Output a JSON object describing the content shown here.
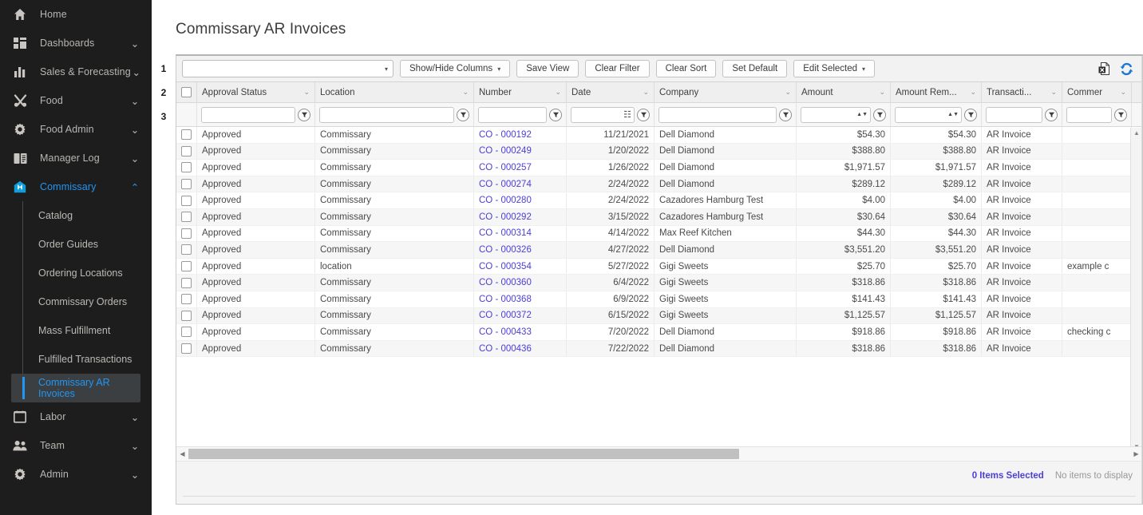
{
  "sidebar": {
    "items": [
      {
        "label": "Home",
        "icon": "home-icon",
        "expandable": false
      },
      {
        "label": "Dashboards",
        "icon": "dashboard-icon",
        "expandable": true,
        "chevron": "⌄"
      },
      {
        "label": "Sales & Forecasting",
        "icon": "bar-chart-icon",
        "expandable": true,
        "chevron": "⌄"
      },
      {
        "label": "Food",
        "icon": "utensils-icon",
        "expandable": true,
        "chevron": "⌄"
      },
      {
        "label": "Food Admin",
        "icon": "gear-icon",
        "expandable": true,
        "chevron": "⌄"
      },
      {
        "label": "Manager Log",
        "icon": "book-icon",
        "expandable": true,
        "chevron": "⌄"
      },
      {
        "label": "Commissary",
        "icon": "commissary-icon",
        "expandable": true,
        "chevron": "⌃",
        "active": true
      }
    ],
    "sub_items": [
      {
        "label": "Catalog"
      },
      {
        "label": "Order Guides"
      },
      {
        "label": "Ordering Locations"
      },
      {
        "label": "Commissary Orders"
      },
      {
        "label": "Mass Fulfillment"
      },
      {
        "label": "Fulfilled Transactions"
      },
      {
        "label": "Commissary AR Invoices",
        "current": true
      }
    ],
    "bottom_items": [
      {
        "label": "Labor",
        "icon": "calendar-icon",
        "chevron": "⌄"
      },
      {
        "label": "Team",
        "icon": "people-icon",
        "chevron": "⌄"
      },
      {
        "label": "Admin",
        "icon": "gear-icon",
        "chevron": "⌄"
      }
    ],
    "accent_color": "#2196f3"
  },
  "page": {
    "title": "Commissary AR Invoices",
    "markers": [
      "1",
      "2",
      "3"
    ]
  },
  "toolbar": {
    "view_select_value": "",
    "view_select_caret": "▾",
    "show_hide_columns": "Show/Hide Columns",
    "show_hide_caret": "▾",
    "save_view": "Save View",
    "clear_filter": "Clear Filter",
    "clear_sort": "Clear Sort",
    "set_default": "Set Default",
    "edit_selected": "Edit Selected",
    "edit_selected_caret": "▾",
    "export_icon": "export-excel-icon",
    "refresh_icon": "refresh-icon"
  },
  "grid": {
    "columns": [
      {
        "key": "check",
        "label": "",
        "width": 26,
        "type": "check",
        "filter": "none"
      },
      {
        "key": "status",
        "label": "Approval Status",
        "width": 148,
        "type": "text",
        "filter": "text"
      },
      {
        "key": "location",
        "label": "Location",
        "width": 199,
        "type": "text",
        "filter": "text"
      },
      {
        "key": "number",
        "label": "Number",
        "width": 116,
        "type": "link",
        "filter": "text"
      },
      {
        "key": "date",
        "label": "Date",
        "width": 110,
        "type": "num",
        "filter": "date"
      },
      {
        "key": "company",
        "label": "Company",
        "width": 178,
        "type": "text",
        "filter": "text"
      },
      {
        "key": "amount",
        "label": "Amount",
        "width": 118,
        "type": "num",
        "filter": "spin"
      },
      {
        "key": "remaining",
        "label": "Amount Rem...",
        "width": 114,
        "type": "num",
        "filter": "spin"
      },
      {
        "key": "trantype",
        "label": "Transacti...",
        "width": 101,
        "type": "text",
        "filter": "text"
      },
      {
        "key": "comment",
        "label": "Commer",
        "width": 87,
        "type": "text",
        "filter": "text"
      }
    ],
    "header_chevron": "⌄",
    "rows": [
      {
        "status": "Approved",
        "location": "Commissary",
        "number": "CO - 000192",
        "date": "11/21/2021",
        "company": "Dell Diamond",
        "amount": "$54.30",
        "remaining": "$54.30",
        "trantype": "AR Invoice",
        "comment": ""
      },
      {
        "status": "Approved",
        "location": "Commissary",
        "number": "CO - 000249",
        "date": "1/20/2022",
        "company": "Dell Diamond",
        "amount": "$388.80",
        "remaining": "$388.80",
        "trantype": "AR Invoice",
        "comment": ""
      },
      {
        "status": "Approved",
        "location": "Commissary",
        "number": "CO - 000257",
        "date": "1/26/2022",
        "company": "Dell Diamond",
        "amount": "$1,971.57",
        "remaining": "$1,971.57",
        "trantype": "AR Invoice",
        "comment": ""
      },
      {
        "status": "Approved",
        "location": "Commissary",
        "number": "CO - 000274",
        "date": "2/24/2022",
        "company": "Dell Diamond",
        "amount": "$289.12",
        "remaining": "$289.12",
        "trantype": "AR Invoice",
        "comment": ""
      },
      {
        "status": "Approved",
        "location": "Commissary",
        "number": "CO - 000280",
        "date": "2/24/2022",
        "company": "Cazadores Hamburg Test",
        "amount": "$4.00",
        "remaining": "$4.00",
        "trantype": "AR Invoice",
        "comment": ""
      },
      {
        "status": "Approved",
        "location": "Commissary",
        "number": "CO - 000292",
        "date": "3/15/2022",
        "company": "Cazadores Hamburg Test",
        "amount": "$30.64",
        "remaining": "$30.64",
        "trantype": "AR Invoice",
        "comment": ""
      },
      {
        "status": "Approved",
        "location": "Commissary",
        "number": "CO - 000314",
        "date": "4/14/2022",
        "company": "Max Reef Kitchen",
        "amount": "$44.30",
        "remaining": "$44.30",
        "trantype": "AR Invoice",
        "comment": ""
      },
      {
        "status": "Approved",
        "location": "Commissary",
        "number": "CO - 000326",
        "date": "4/27/2022",
        "company": "Dell Diamond",
        "amount": "$3,551.20",
        "remaining": "$3,551.20",
        "trantype": "AR Invoice",
        "comment": ""
      },
      {
        "status": "Approved",
        "location": "location",
        "number": "CO - 000354",
        "date": "5/27/2022",
        "company": "Gigi Sweets",
        "amount": "$25.70",
        "remaining": "$25.70",
        "trantype": "AR Invoice",
        "comment": "example c"
      },
      {
        "status": "Approved",
        "location": "Commissary",
        "number": "CO - 000360",
        "date": "6/4/2022",
        "company": "Gigi Sweets",
        "amount": "$318.86",
        "remaining": "$318.86",
        "trantype": "AR Invoice",
        "comment": ""
      },
      {
        "status": "Approved",
        "location": "Commissary",
        "number": "CO - 000368",
        "date": "6/9/2022",
        "company": "Gigi Sweets",
        "amount": "$141.43",
        "remaining": "$141.43",
        "trantype": "AR Invoice",
        "comment": ""
      },
      {
        "status": "Approved",
        "location": "Commissary",
        "number": "CO - 000372",
        "date": "6/15/2022",
        "company": "Gigi Sweets",
        "amount": "$1,125.57",
        "remaining": "$1,125.57",
        "trantype": "AR Invoice",
        "comment": ""
      },
      {
        "status": "Approved",
        "location": "Commissary",
        "number": "CO - 000433",
        "date": "7/20/2022",
        "company": "Dell Diamond",
        "amount": "$918.86",
        "remaining": "$918.86",
        "trantype": "AR Invoice",
        "comment": "checking c"
      },
      {
        "status": "Approved",
        "location": "Commissary",
        "number": "CO - 000436",
        "date": "7/22/2022",
        "company": "Dell Diamond",
        "amount": "$318.86",
        "remaining": "$318.86",
        "trantype": "AR Invoice",
        "comment": ""
      }
    ]
  },
  "footer": {
    "items_selected": "0 Items Selected",
    "no_items": "No items to display",
    "selected_color": "#4b3fd8"
  },
  "scroll": {
    "up_arrow": "▲",
    "down_arrow": "▼",
    "left_arrow": "◀",
    "right_arrow": "▶"
  }
}
